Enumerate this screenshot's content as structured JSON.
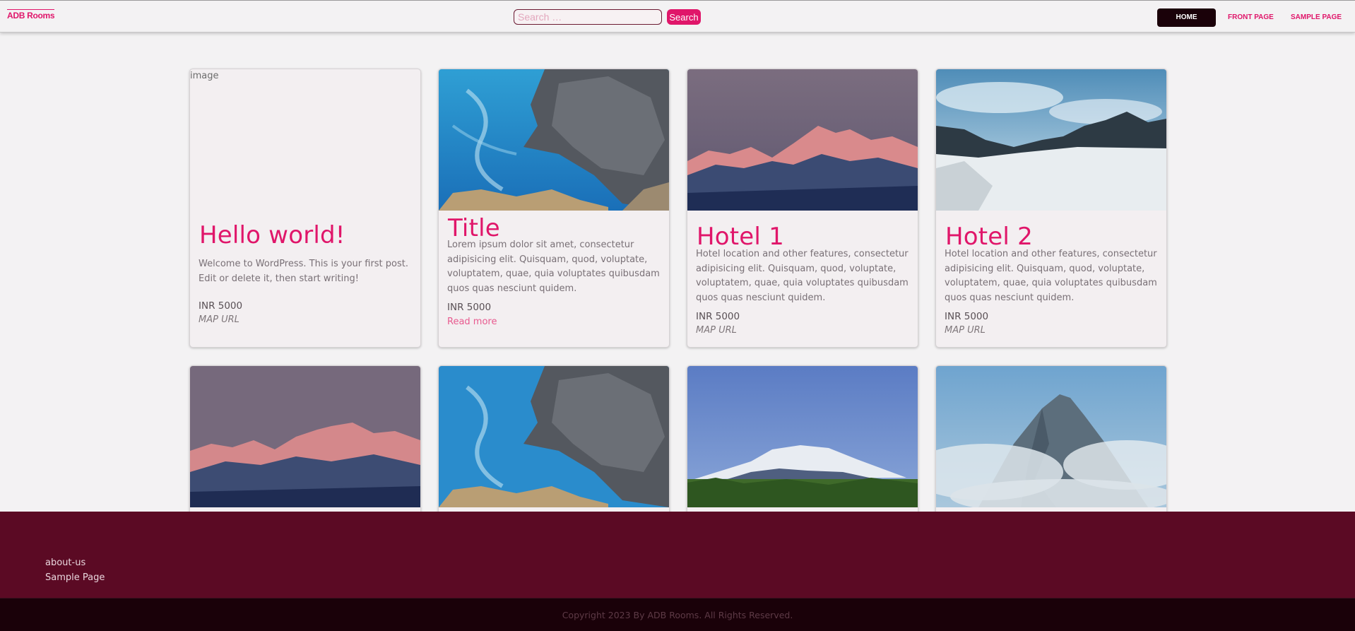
{
  "header": {
    "logo_text": "ADB Rooms",
    "search_placeholder": "Search …",
    "search_button": "Search",
    "nav": [
      "HOME",
      "FRONT PAGE",
      "SAMPLE PAGE"
    ]
  },
  "cards": [
    {
      "image_alt": "image",
      "title": "Hello world!",
      "description": "Welcome to WordPress. This is your first post. Edit or delete it, then start writing!",
      "price": "INR 5000",
      "map": "MAP URL"
    },
    {
      "title": "Title",
      "description": "Lorem ipsum dolor sit amet, consectetur adipisicing elit. Quisquam, quod, voluptate, voluptatem, quae, quia voluptates quibusdam quos quas nesciunt quidem.",
      "price": "INR 5000",
      "read_more": "Read more"
    },
    {
      "title": "Hotel 1",
      "description": "Hotel location and other features, consectetur adipisicing elit. Quisquam, quod, voluptate, voluptatem, quae, quia voluptates quibusdam quos quas nesciunt quidem.",
      "price": "INR 5000",
      "map": "MAP URL"
    },
    {
      "title": "Hotel 2",
      "description": "Hotel location and other features, consectetur adipisicing elit. Quisquam, quod, voluptate, voluptatem, quae, quia voluptates quibusdam quos quas nesciunt quidem.",
      "price": "INR 5000",
      "map": "MAP URL"
    }
  ],
  "footer": {
    "links": [
      "about-us",
      "Sample Page"
    ],
    "copyright": "Copyright 2023 By ADB Rooms. All Rights Reserved."
  },
  "colors": {
    "accent": "#e0166a",
    "footer": "#5b0a24",
    "footer_bottom": "#1a0109",
    "nav_active": "#1a0109"
  }
}
